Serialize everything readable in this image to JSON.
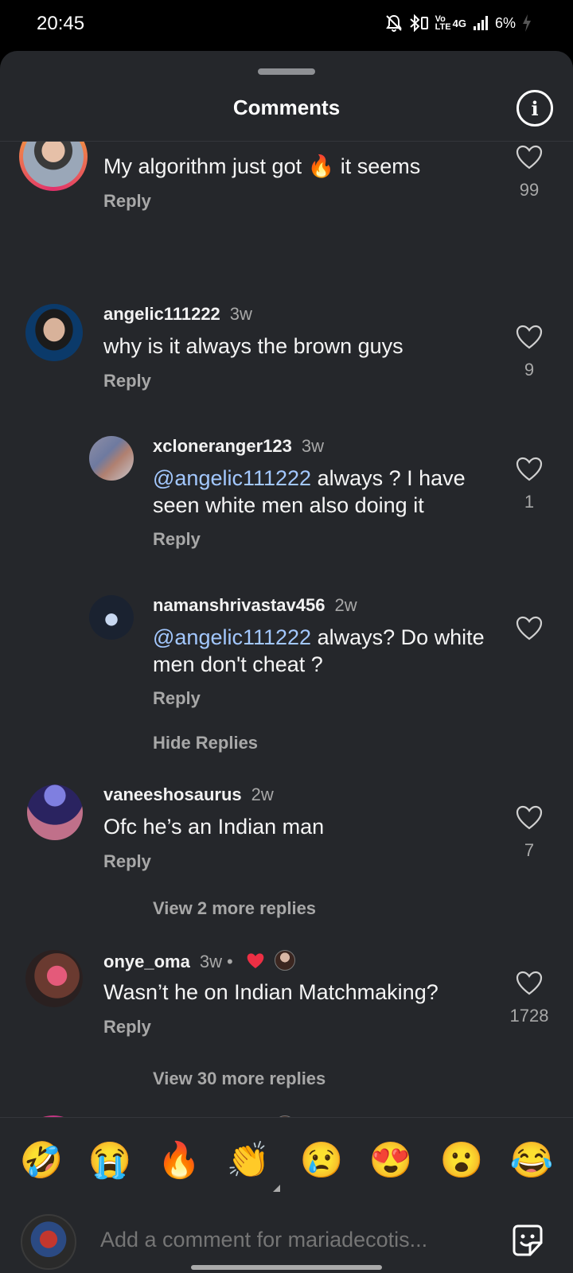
{
  "status_bar": {
    "time": "20:45",
    "battery": "6%",
    "network": "4G",
    "volte": "Vo LTE"
  },
  "sheet": {
    "title": "Comments",
    "info_icon": "i"
  },
  "comments": [
    {
      "username": "",
      "time": "",
      "text": "My algorithm just got 🔥 it seems",
      "reply": "Reply",
      "likes": "99"
    },
    {
      "username": "angelic111222",
      "time": "3w",
      "text": "why is it always the brown guys",
      "reply": "Reply",
      "likes": "9"
    },
    {
      "username": "xcloneranger123",
      "time": "3w",
      "mention": "@angelic111222",
      "text": " always ? I have seen white men also doing it",
      "reply": "Reply",
      "likes": "1"
    },
    {
      "username": "namanshrivastav456",
      "time": "2w",
      "mention": "@angelic111222",
      "text": " always? Do white men don't cheat ?",
      "reply": "Reply",
      "likes": ""
    },
    {
      "username": "vaneeshosaurus",
      "time": "2w",
      "text": "Ofc he’s an Indian man",
      "reply": "Reply",
      "likes": "7"
    },
    {
      "username": "onye_oma",
      "time": "3w",
      "dot": "•",
      "text": "Wasn’t he on Indian Matchmaking?",
      "reply": "Reply",
      "likes": "1728"
    },
    {
      "username": "gajra_galli",
      "time": "1w",
      "dot": "•"
    }
  ],
  "links": {
    "hide_replies": "Hide Replies",
    "view_more_2": "View 2 more replies",
    "view_more_30": "View 30 more replies"
  },
  "emoji_bar": [
    "🤣",
    "😭",
    "🔥",
    "👏",
    "😢",
    "😍",
    "😮",
    "😂"
  ],
  "composer": {
    "placeholder": "Add a comment for mariadecotis..."
  },
  "colors": {
    "sheet_bg": "#25272b",
    "mention": "#a3c8ff",
    "secondary_text": "#a8a8a8",
    "like_red": "#ed2f44"
  }
}
